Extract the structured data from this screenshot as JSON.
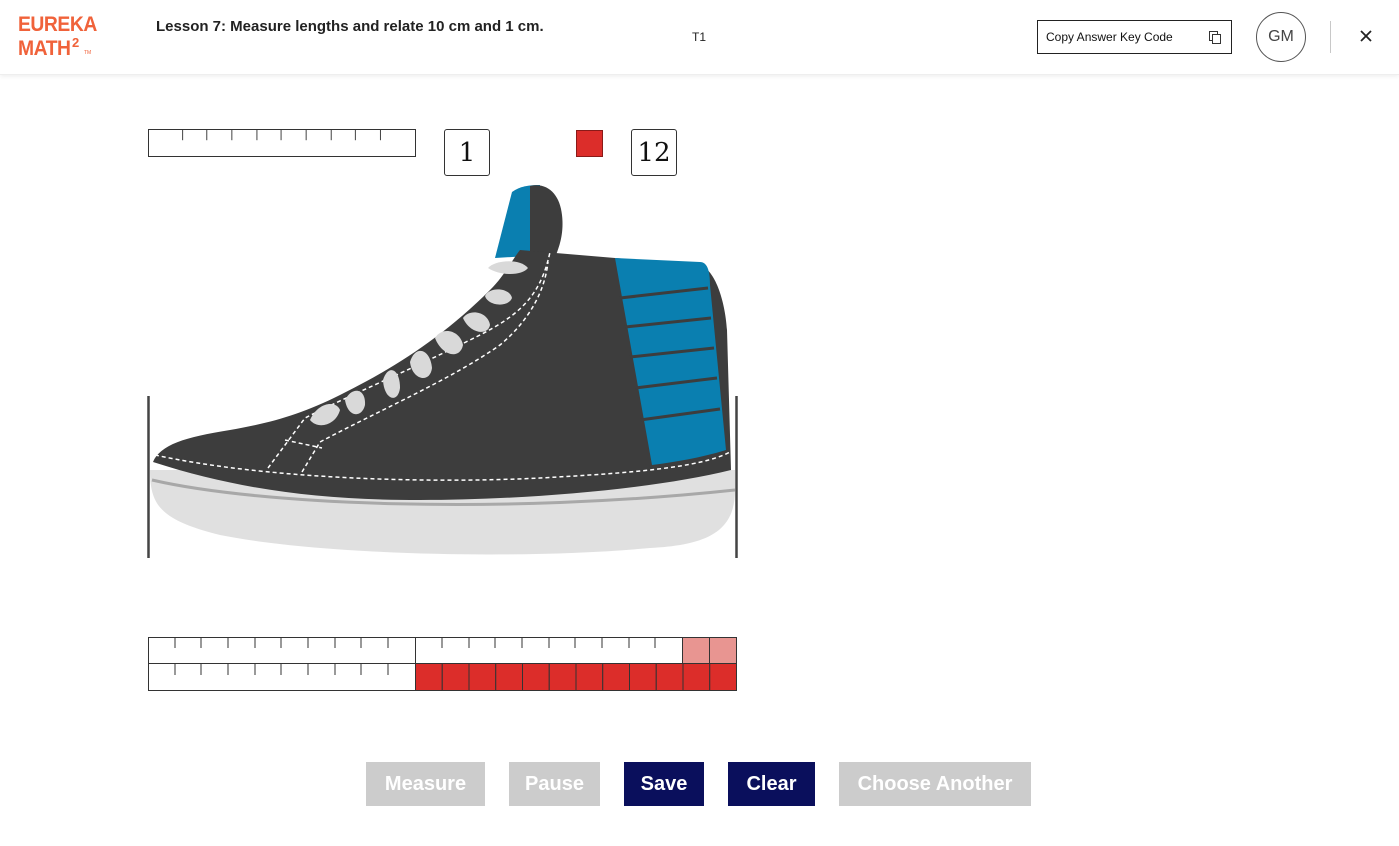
{
  "header": {
    "logo_line1": "EUREKA",
    "logo_line2": "MATH",
    "logo_sup": "2",
    "logo_tm": "TM",
    "lesson_title": "Lesson 7: Measure lengths and relate 10 cm and 1 cm.",
    "tag": "T1",
    "copy_label": "Copy Answer Key Code",
    "avatar_initials": "GM"
  },
  "measure": {
    "ten_stick_count": "1",
    "unit_count": "12",
    "unit_color": "#dc2d2a",
    "preview_color": "#e89591"
  },
  "buttons": {
    "measure": "Measure",
    "pause": "Pause",
    "save": "Save",
    "clear": "Clear",
    "choose_another": "Choose Another"
  },
  "colors": {
    "brand": "#f0623a",
    "button_active": "#0a0f5c",
    "button_disabled": "#cccccc",
    "shoe_body": "#3d3d3d",
    "shoe_accent": "#0a7fb0",
    "sole": "#e0e0e0"
  }
}
